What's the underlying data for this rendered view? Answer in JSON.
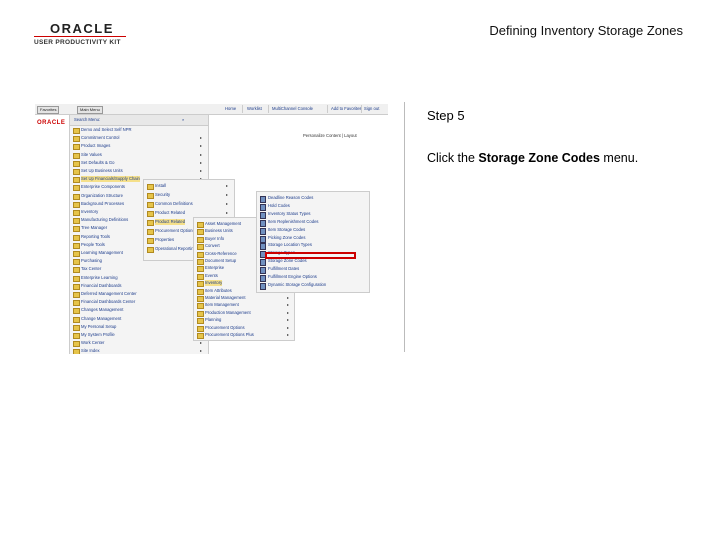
{
  "header": {
    "logo_word": "ORACLE",
    "logo_sub": "USER PRODUCTIVITY KIT",
    "doc_title": "Defining Inventory Storage Zones"
  },
  "step": {
    "label": "Step 5",
    "instruction_prefix": "Click the ",
    "instruction_target": "Storage Zone Codes",
    "instruction_suffix": " menu."
  },
  "screenshot": {
    "top_buttons": [
      "Favorites",
      "Main Menu"
    ],
    "nav_links": [
      "Home",
      "Worklist",
      "MultiChannel Console",
      "Add to Favorites",
      "Sign out"
    ],
    "personalize": "Personalize Content | Layout",
    "oracle_logo": "ORACLE",
    "search_label": "Search Menu:",
    "menu1_items": [
      "Demo and Select Self NPR",
      "Commitment Control",
      "Product Images",
      "Site Values",
      "Set Defaults & Go",
      "Set Up Business Units",
      "Set Up Financials/Supply Chain",
      "Enterprise Components",
      "Organization Structure",
      "Background Processes",
      "Inventory",
      "Manufacturing Definitions",
      "Tree Manager",
      "Reporting Tools",
      "People Tools",
      "Learning Management",
      "Purchasing",
      "Tax Center",
      "Enterprise Learning",
      "Financial Dashboards",
      "Deferred Management Center",
      "Financial Dashboards Center",
      "Changes Management",
      "Change Management",
      "My Personal Setup",
      "My System Profile",
      "Work Center",
      "Site Index"
    ],
    "menu2_items": [
      "Install",
      "Security",
      "Common Definitions",
      "Product Related",
      "Product Related",
      "Procurement Options",
      "Properties",
      "Operational Reporting"
    ],
    "menu3_items": [
      "Asset Management",
      "Business Units",
      "Buyer Info",
      "Convert",
      "Cross-Reference",
      "Document Setup",
      "Enterprise",
      "Events",
      "Inventory",
      "Item Attributes",
      "Material Management",
      "Item Management",
      "Production Management",
      "Planning",
      "Procurement Options",
      "Procurement Options Plus"
    ],
    "menu4_items": [
      "Deadline Reason Codes",
      "Hold Codes",
      "Inventory Status Types",
      "Item Replenishment Codes",
      "Item Storage Codes",
      "Picking Zone Codes",
      "Storage Location Types",
      "Storage Types",
      "Storage Zone Codes",
      "Fulfillment Dates",
      "Fulfillment Engine Options",
      "Dynamic Storage Configuration"
    ]
  }
}
